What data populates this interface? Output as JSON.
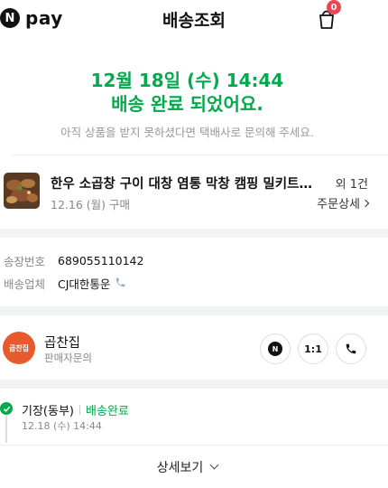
{
  "header": {
    "logo_n": "N",
    "logo_text": "pay",
    "title": "배송조회",
    "cart_count": "0"
  },
  "status": {
    "date_line": "12월 18일 (수) 14:44",
    "main_line": "배송 완료 되었어요.",
    "sub_line": "아직 상품을 받지 못하셨다면 택배사로 문의해 주세요."
  },
  "product": {
    "name": "한우 소곱창 구이 대창 염통 막창 캠핑 밀키트 선물세트",
    "order_date": "12.16 (월) 구매",
    "count": "외 1건",
    "detail_label": "주문상세"
  },
  "tracking": {
    "invoice_label": "송장번호",
    "invoice_value": "689055110142",
    "carrier_label": "배송업체",
    "carrier_value": "CJ대한통운"
  },
  "seller": {
    "logo_text": "곱찬집",
    "name": "곱찬집",
    "sub": "판매자문의",
    "talk_label": "N",
    "chat_label": "1:1"
  },
  "timeline": {
    "place": "기장(동부)",
    "state": "배송완료",
    "time": "12.18 (수) 14:44"
  },
  "more_label": "상세보기",
  "colors": {
    "accent_green": "#03a94d",
    "badge_red": "#f04452",
    "seller_orange": "#e8592b"
  }
}
